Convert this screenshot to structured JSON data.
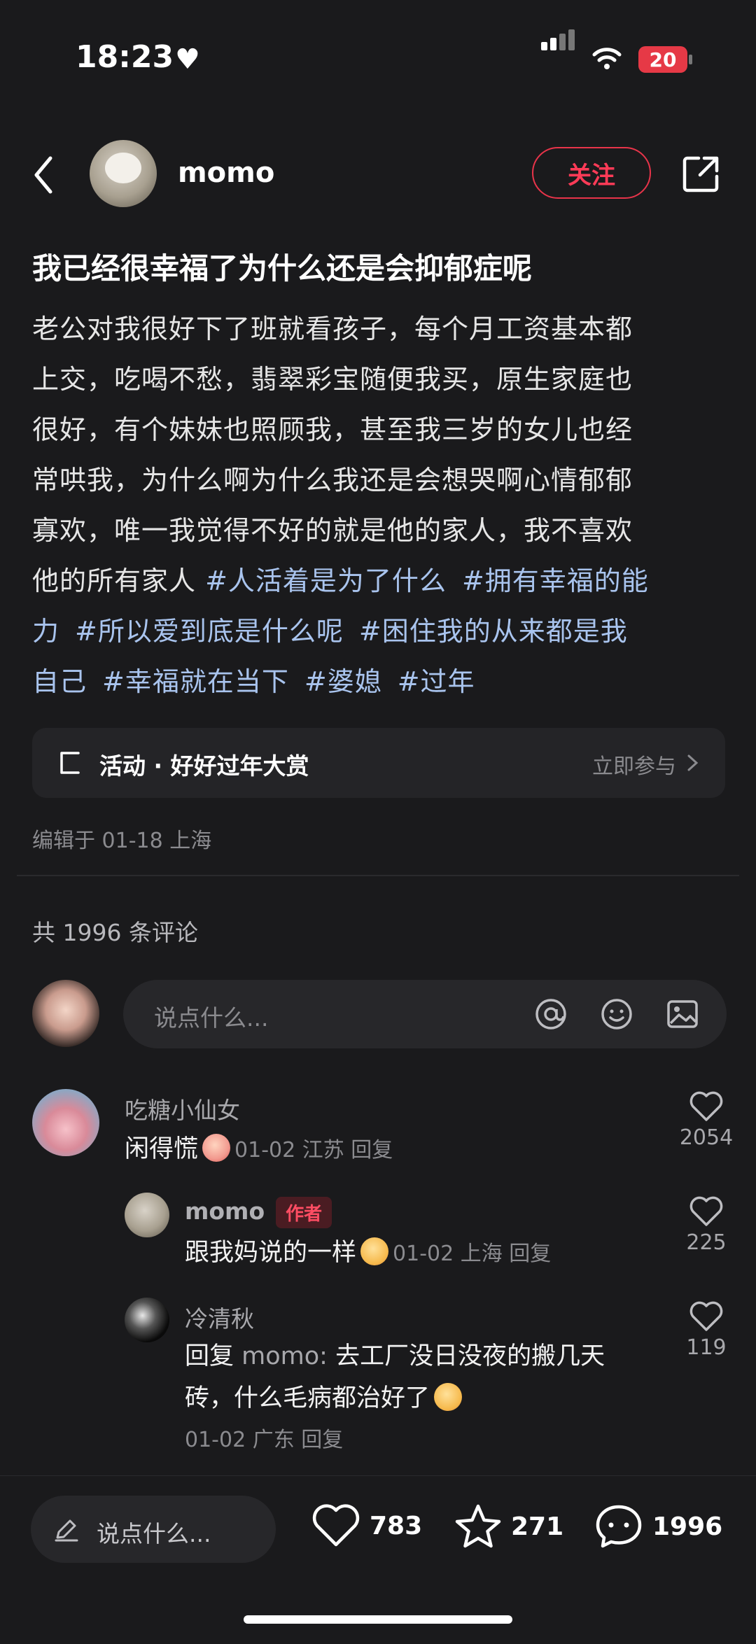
{
  "status": {
    "time": "18:23",
    "battery": "20"
  },
  "header": {
    "username": "momo",
    "follow_label": "关注"
  },
  "post": {
    "title": "我已经很幸福了为什么还是会抑郁症呢",
    "body_lines": [
      "老公对我很好下了班就看孩子，每个月工资基本都",
      "上交，吃喝不愁，翡翠彩宝随便我买，原生家庭也",
      "很好，有个妹妹也照顾我，甚至我三岁的女儿也经",
      "常哄我，为什么啊为什么我还是会想哭啊心情郁郁",
      "寡欢，唯一我觉得不好的就是他的家人，我不喜欢"
    ],
    "line6_text": "他的所有家人 ",
    "tags": [
      "#人活着是为了什么",
      "#拥有幸福的能",
      "力",
      "#所以爱到底是什么呢",
      "#困住我的从来都是我",
      "自己",
      "#幸福就在当下",
      "#婆媳",
      "#过年"
    ]
  },
  "activity": {
    "title": "活动 · 好好过年大赏",
    "action": "立即参与"
  },
  "edit_meta": "编辑于 01-18 上海",
  "comments_header": "共 1996 条评论",
  "comment_input": {
    "placeholder": "说点什么..."
  },
  "comments": [
    {
      "name": "吃糖小仙女",
      "text": "闲得慌",
      "meta": "01-02 江苏 回复",
      "likes": "2054"
    },
    {
      "name": "momo",
      "badge": "作者",
      "text": "跟我妈说的一样",
      "meta": "01-02 上海 回复",
      "likes": "225"
    },
    {
      "name": "冷清秋",
      "reply_prefix": "回复 ",
      "reply_to": "momo: ",
      "text_line1": "去工厂没日没夜的搬几天",
      "text_line2": "砖，什么毛病都治好了",
      "meta": "01-02 广东 回复",
      "likes": "119"
    }
  ],
  "bottom_bar": {
    "placeholder": "说点什么...",
    "likes": "783",
    "favorites": "271",
    "comments": "1996"
  },
  "colors": {
    "background": "#1a1a1c",
    "accent": "#ff3b57",
    "tag": "#a9c4ee"
  }
}
